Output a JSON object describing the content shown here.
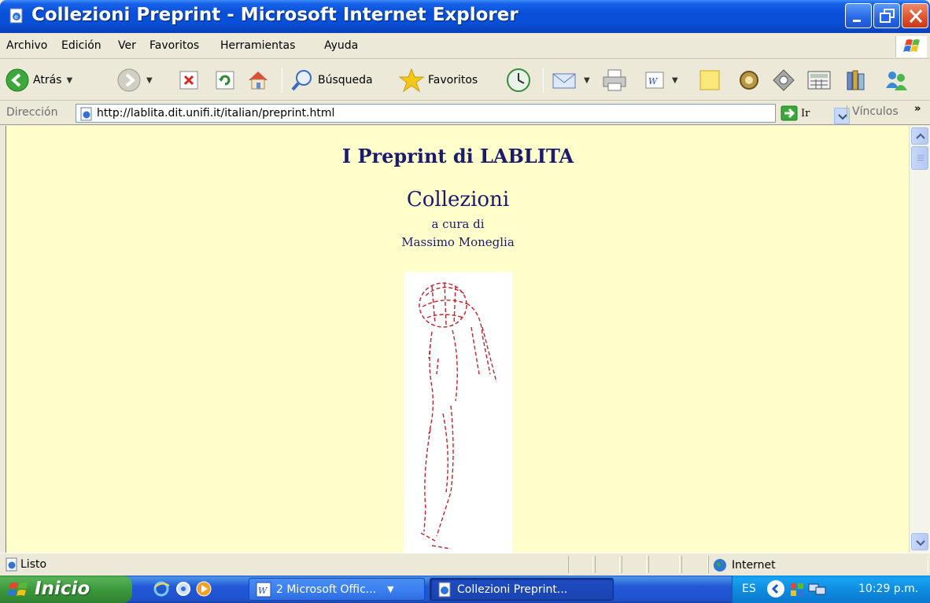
{
  "window": {
    "title": "Collezioni Preprint - Microsoft Internet Explorer",
    "colors": {
      "titlebar": "#0a4fd8",
      "close_button": "#e0512c"
    }
  },
  "menu": {
    "items": [
      "Archivo",
      "Edición",
      "Ver",
      "Favoritos",
      "Herramientas",
      "Ayuda"
    ]
  },
  "toolbar": {
    "back_label": "Atrás",
    "search_label": "Búsqueda",
    "favorites_label": "Favoritos",
    "icons": [
      "back-icon",
      "forward-icon",
      "stop-icon",
      "refresh-icon",
      "home-icon",
      "search-icon",
      "favorites-star-icon",
      "history-icon",
      "mail-icon",
      "print-icon",
      "word-edit-icon",
      "note-icon",
      "gear-icon",
      "target-icon",
      "calculator-icon",
      "books-icon",
      "users-icon"
    ]
  },
  "address": {
    "label": "Dirección",
    "url": "http://lablita.dit.unifi.it/italian/preprint.html",
    "go_label": "Ir",
    "links_label": "Vínculos"
  },
  "page": {
    "heading": "I Preprint di LABLITA",
    "subheading": "Collezioni",
    "curated_by": "a cura di",
    "editor": "Massimo Moneglia",
    "background_color": "#ffffcc",
    "text_color": "#1a1a6e",
    "figure_icon": "line-drawing-figure"
  },
  "status": {
    "text": "Listo",
    "zone": "Internet"
  },
  "taskbar": {
    "start_label": "Inicio",
    "tasks": [
      {
        "label": "2 Microsoft Offic...",
        "icon": "word-icon"
      },
      {
        "label": "Collezioni Preprint...",
        "icon": "ie-icon"
      }
    ],
    "language": "ES",
    "time": "10:29 p.m."
  }
}
